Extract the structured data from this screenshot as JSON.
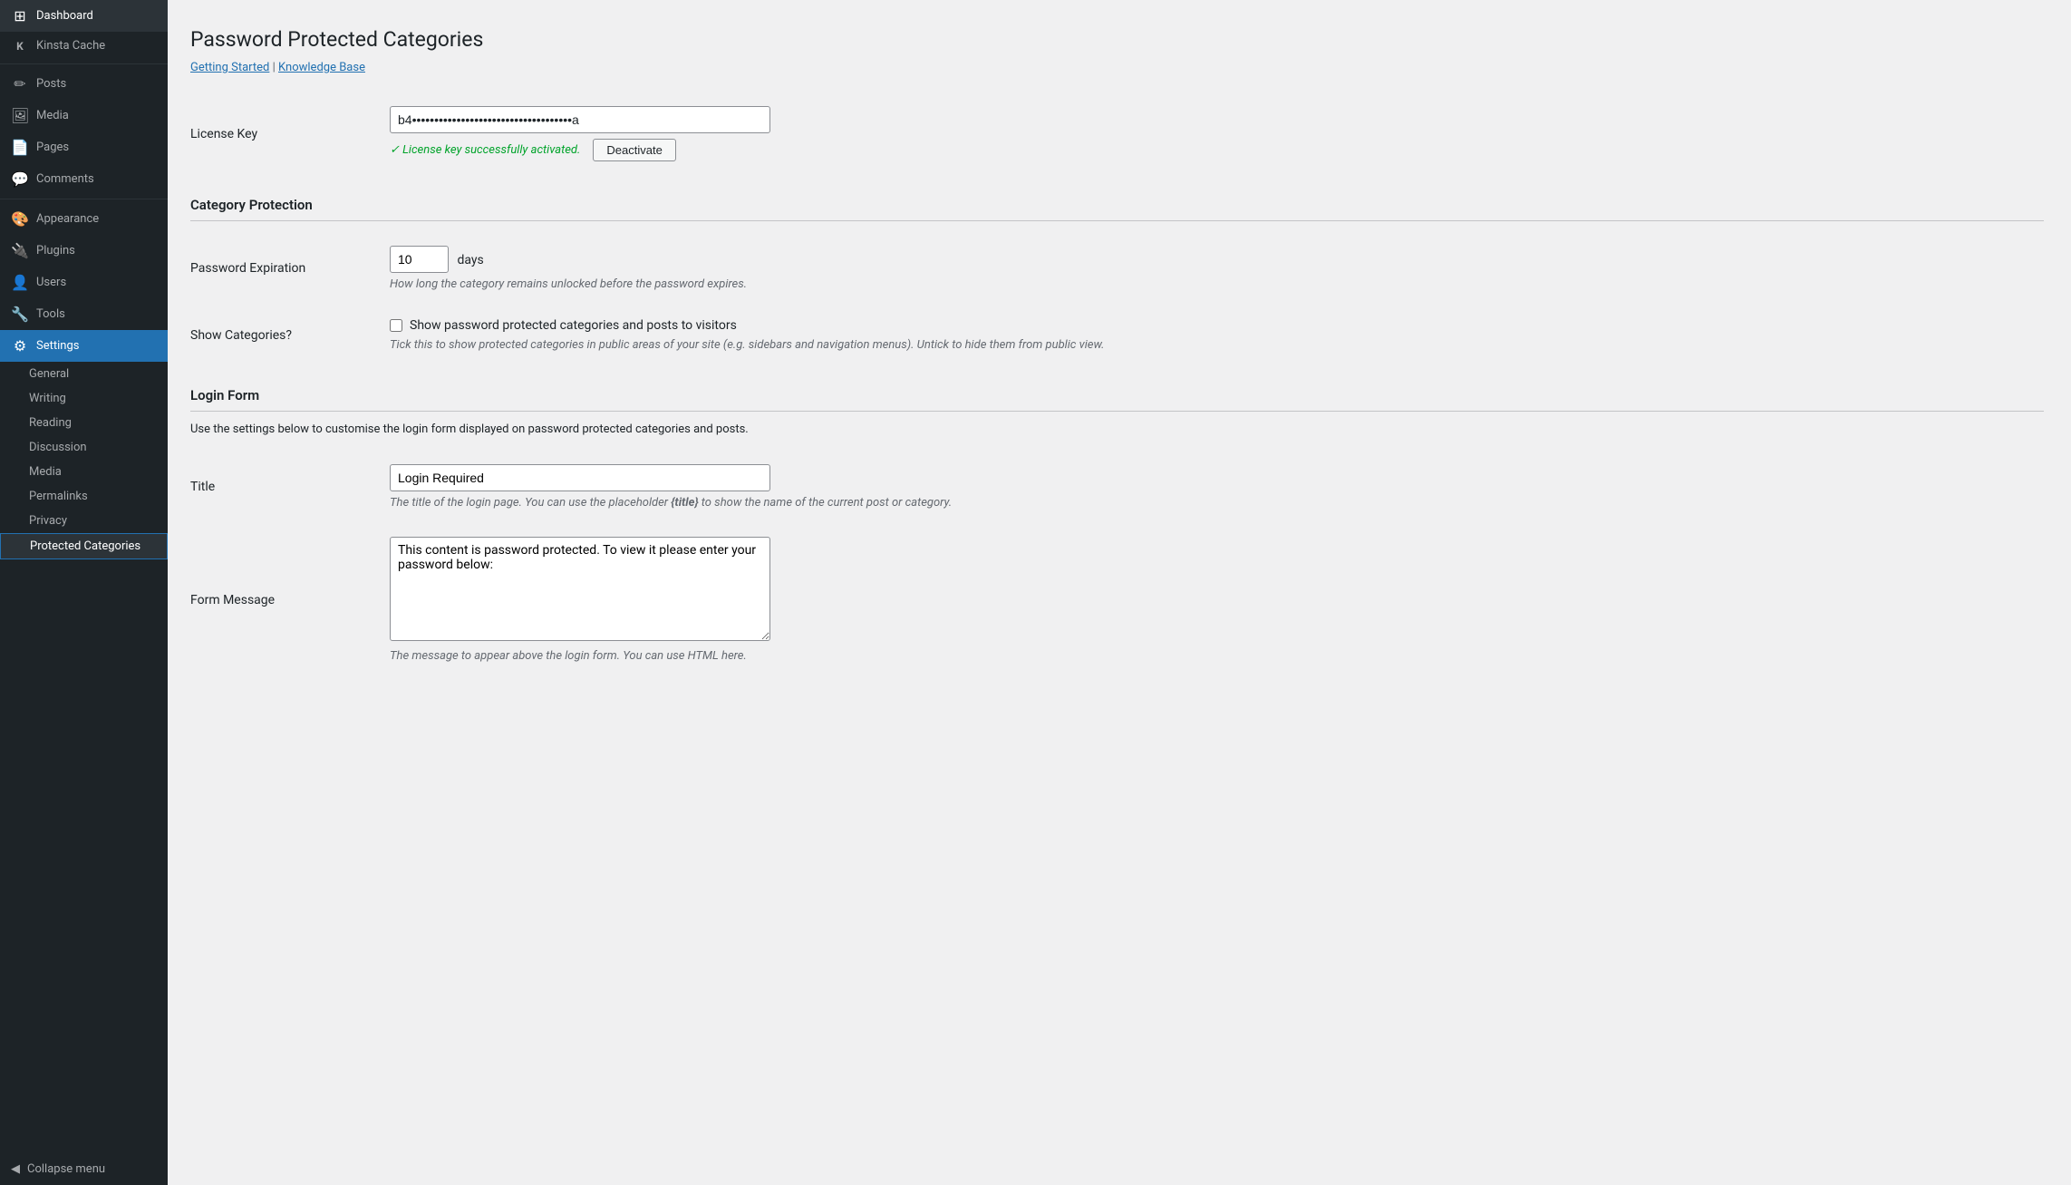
{
  "sidebar": {
    "items": [
      {
        "id": "dashboard",
        "label": "Dashboard",
        "icon": "⊞",
        "active": false
      },
      {
        "id": "kinsta-cache",
        "label": "Kinsta Cache",
        "icon": "K",
        "active": false
      },
      {
        "id": "posts",
        "label": "Posts",
        "icon": "📄",
        "active": false
      },
      {
        "id": "media",
        "label": "Media",
        "icon": "🖼",
        "active": false
      },
      {
        "id": "pages",
        "label": "Pages",
        "icon": "📑",
        "active": false
      },
      {
        "id": "comments",
        "label": "Comments",
        "icon": "💬",
        "active": false
      },
      {
        "id": "appearance",
        "label": "Appearance",
        "icon": "🎨",
        "active": false
      },
      {
        "id": "plugins",
        "label": "Plugins",
        "icon": "🔌",
        "active": false
      },
      {
        "id": "users",
        "label": "Users",
        "icon": "👤",
        "active": false
      },
      {
        "id": "tools",
        "label": "Tools",
        "icon": "🔧",
        "active": false
      },
      {
        "id": "settings",
        "label": "Settings",
        "icon": "⚙",
        "active": true
      }
    ],
    "submenu": [
      {
        "id": "general",
        "label": "General",
        "active": false
      },
      {
        "id": "writing",
        "label": "Writing",
        "active": false
      },
      {
        "id": "reading",
        "label": "Reading",
        "active": false
      },
      {
        "id": "discussion",
        "label": "Discussion",
        "active": false
      },
      {
        "id": "media",
        "label": "Media",
        "active": false
      },
      {
        "id": "permalinks",
        "label": "Permalinks",
        "active": false
      },
      {
        "id": "privacy",
        "label": "Privacy",
        "active": false
      },
      {
        "id": "protected-categories",
        "label": "Protected Categories",
        "active": true
      }
    ],
    "collapse_label": "Collapse menu"
  },
  "page": {
    "title": "Password Protected Categories",
    "breadcrumbs": [
      {
        "id": "getting-started",
        "label": "Getting Started"
      },
      {
        "id": "knowledge-base",
        "label": "Knowledge Base"
      }
    ],
    "breadcrumb_separator": "|"
  },
  "license": {
    "label": "License Key",
    "value": "b4••••••••••••••••••••••••••••••••••••a",
    "success_text": "✓ License key successfully activated.",
    "deactivate_label": "Deactivate"
  },
  "category_protection": {
    "heading": "Category Protection",
    "password_expiration": {
      "label": "Password Expiration",
      "value": "10",
      "unit": "days",
      "description": "How long the category remains unlocked before the password expires."
    },
    "show_categories": {
      "label": "Show Categories?",
      "checkbox_label": "Show password protected categories and posts to visitors",
      "checked": false,
      "description": "Tick this to show protected categories in public areas of your site (e.g. sidebars and navigation menus). Untick to hide them from public view."
    }
  },
  "login_form": {
    "heading": "Login Form",
    "description": "Use the settings below to customise the login form displayed on password protected categories and posts.",
    "title_field": {
      "label": "Title",
      "value": "Login Required",
      "description": "The title of the login page. You can use the placeholder {title} to show the name of the current post or category."
    },
    "form_message": {
      "label": "Form Message",
      "value": "This content is password protected. To view it please enter your password below:",
      "description": "The message to appear above the login form. You can use HTML here."
    }
  }
}
